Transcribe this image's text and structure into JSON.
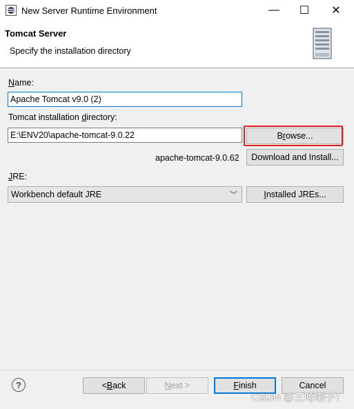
{
  "window": {
    "title": "New Server Runtime Environment",
    "minimize": "—",
    "maximize": "☐",
    "close": "✕"
  },
  "header": {
    "title": "Tomcat Server",
    "subtitle": "Specify the installation directory"
  },
  "form": {
    "name_label_mn": "N",
    "name_label_rest": "ame:",
    "name_value": "Apache Tomcat v9.0 (2)",
    "dir_label_pre": "Tomcat installation ",
    "dir_label_mn": "d",
    "dir_label_post": "irectory:",
    "dir_value": "E:\\ENV20\\apache-tomcat-9.0.22",
    "browse_pre": "B",
    "browse_mn": "r",
    "browse_post": "owse...",
    "download_version": "apache-tomcat-9.0.62",
    "download_label": "Download and Install...",
    "jre_label_mn": "J",
    "jre_label_rest": "RE:",
    "jre_value": "Workbench default JRE",
    "installed_jres_mn": "I",
    "installed_jres_rest": "nstalled JREs..."
  },
  "footer": {
    "help": "?",
    "back_pre": "< ",
    "back_mn": "B",
    "back_post": "ack",
    "next_mn": "N",
    "next_post": "ext >",
    "finish_mn": "F",
    "finish_post": "inish",
    "cancel": "Cancel"
  },
  "watermark": "CSDN @三哈喇子！",
  "colors": {
    "highlight": "#e02020",
    "focus": "#0078d7"
  }
}
